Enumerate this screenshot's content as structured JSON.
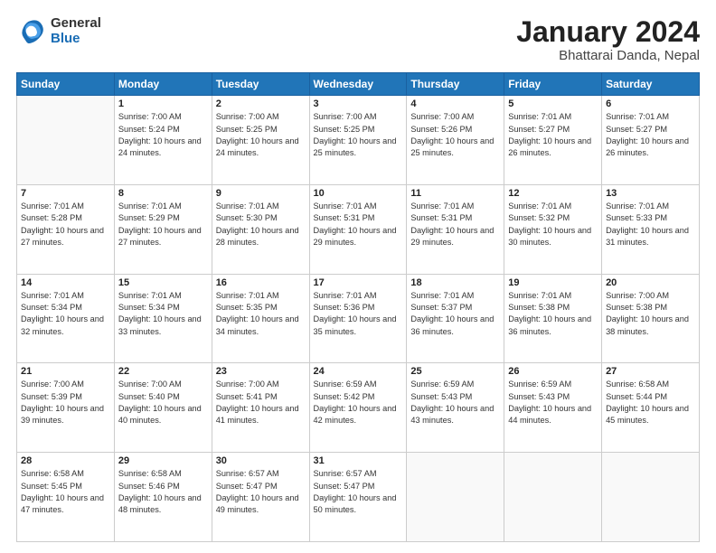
{
  "header": {
    "logo_general": "General",
    "logo_blue": "Blue",
    "title": "January 2024",
    "location": "Bhattarai Danda, Nepal"
  },
  "calendar": {
    "days_of_week": [
      "Sunday",
      "Monday",
      "Tuesday",
      "Wednesday",
      "Thursday",
      "Friday",
      "Saturday"
    ],
    "weeks": [
      [
        {
          "day": "",
          "sunrise": "",
          "sunset": "",
          "daylight": ""
        },
        {
          "day": "1",
          "sunrise": "7:00 AM",
          "sunset": "5:24 PM",
          "daylight": "10 hours and 24 minutes."
        },
        {
          "day": "2",
          "sunrise": "7:00 AM",
          "sunset": "5:25 PM",
          "daylight": "10 hours and 24 minutes."
        },
        {
          "day": "3",
          "sunrise": "7:00 AM",
          "sunset": "5:25 PM",
          "daylight": "10 hours and 25 minutes."
        },
        {
          "day": "4",
          "sunrise": "7:00 AM",
          "sunset": "5:26 PM",
          "daylight": "10 hours and 25 minutes."
        },
        {
          "day": "5",
          "sunrise": "7:01 AM",
          "sunset": "5:27 PM",
          "daylight": "10 hours and 26 minutes."
        },
        {
          "day": "6",
          "sunrise": "7:01 AM",
          "sunset": "5:27 PM",
          "daylight": "10 hours and 26 minutes."
        }
      ],
      [
        {
          "day": "7",
          "sunrise": "7:01 AM",
          "sunset": "5:28 PM",
          "daylight": "10 hours and 27 minutes."
        },
        {
          "day": "8",
          "sunrise": "7:01 AM",
          "sunset": "5:29 PM",
          "daylight": "10 hours and 27 minutes."
        },
        {
          "day": "9",
          "sunrise": "7:01 AM",
          "sunset": "5:30 PM",
          "daylight": "10 hours and 28 minutes."
        },
        {
          "day": "10",
          "sunrise": "7:01 AM",
          "sunset": "5:31 PM",
          "daylight": "10 hours and 29 minutes."
        },
        {
          "day": "11",
          "sunrise": "7:01 AM",
          "sunset": "5:31 PM",
          "daylight": "10 hours and 29 minutes."
        },
        {
          "day": "12",
          "sunrise": "7:01 AM",
          "sunset": "5:32 PM",
          "daylight": "10 hours and 30 minutes."
        },
        {
          "day": "13",
          "sunrise": "7:01 AM",
          "sunset": "5:33 PM",
          "daylight": "10 hours and 31 minutes."
        }
      ],
      [
        {
          "day": "14",
          "sunrise": "7:01 AM",
          "sunset": "5:34 PM",
          "daylight": "10 hours and 32 minutes."
        },
        {
          "day": "15",
          "sunrise": "7:01 AM",
          "sunset": "5:34 PM",
          "daylight": "10 hours and 33 minutes."
        },
        {
          "day": "16",
          "sunrise": "7:01 AM",
          "sunset": "5:35 PM",
          "daylight": "10 hours and 34 minutes."
        },
        {
          "day": "17",
          "sunrise": "7:01 AM",
          "sunset": "5:36 PM",
          "daylight": "10 hours and 35 minutes."
        },
        {
          "day": "18",
          "sunrise": "7:01 AM",
          "sunset": "5:37 PM",
          "daylight": "10 hours and 36 minutes."
        },
        {
          "day": "19",
          "sunrise": "7:01 AM",
          "sunset": "5:38 PM",
          "daylight": "10 hours and 36 minutes."
        },
        {
          "day": "20",
          "sunrise": "7:00 AM",
          "sunset": "5:38 PM",
          "daylight": "10 hours and 38 minutes."
        }
      ],
      [
        {
          "day": "21",
          "sunrise": "7:00 AM",
          "sunset": "5:39 PM",
          "daylight": "10 hours and 39 minutes."
        },
        {
          "day": "22",
          "sunrise": "7:00 AM",
          "sunset": "5:40 PM",
          "daylight": "10 hours and 40 minutes."
        },
        {
          "day": "23",
          "sunrise": "7:00 AM",
          "sunset": "5:41 PM",
          "daylight": "10 hours and 41 minutes."
        },
        {
          "day": "24",
          "sunrise": "6:59 AM",
          "sunset": "5:42 PM",
          "daylight": "10 hours and 42 minutes."
        },
        {
          "day": "25",
          "sunrise": "6:59 AM",
          "sunset": "5:43 PM",
          "daylight": "10 hours and 43 minutes."
        },
        {
          "day": "26",
          "sunrise": "6:59 AM",
          "sunset": "5:43 PM",
          "daylight": "10 hours and 44 minutes."
        },
        {
          "day": "27",
          "sunrise": "6:58 AM",
          "sunset": "5:44 PM",
          "daylight": "10 hours and 45 minutes."
        }
      ],
      [
        {
          "day": "28",
          "sunrise": "6:58 AM",
          "sunset": "5:45 PM",
          "daylight": "10 hours and 47 minutes."
        },
        {
          "day": "29",
          "sunrise": "6:58 AM",
          "sunset": "5:46 PM",
          "daylight": "10 hours and 48 minutes."
        },
        {
          "day": "30",
          "sunrise": "6:57 AM",
          "sunset": "5:47 PM",
          "daylight": "10 hours and 49 minutes."
        },
        {
          "day": "31",
          "sunrise": "6:57 AM",
          "sunset": "5:47 PM",
          "daylight": "10 hours and 50 minutes."
        },
        {
          "day": "",
          "sunrise": "",
          "sunset": "",
          "daylight": ""
        },
        {
          "day": "",
          "sunrise": "",
          "sunset": "",
          "daylight": ""
        },
        {
          "day": "",
          "sunrise": "",
          "sunset": "",
          "daylight": ""
        }
      ]
    ]
  }
}
